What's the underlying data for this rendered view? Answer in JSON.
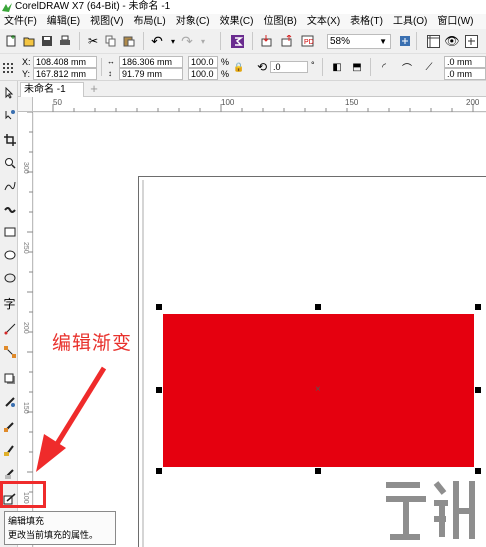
{
  "window": {
    "title": "CorelDRAW X7 (64-Bit) - 未命名 -1"
  },
  "menu": [
    "文件(F)",
    "编辑(E)",
    "视图(V)",
    "布局(L)",
    "对象(C)",
    "效果(C)",
    "位图(B)",
    "文本(X)",
    "表格(T)",
    "工具(O)",
    "窗口(W)"
  ],
  "toolbar": {
    "zoom": "58%"
  },
  "props": {
    "x": "108.408 mm",
    "y": "167.812 mm",
    "w": "186.306 mm",
    "h": "91.79 mm",
    "sx": "100.0",
    "sy": "100.0",
    "pct1": "%",
    "pct2": "%",
    "angle": ".0",
    "deg": "°",
    "r1": ".0 mm",
    "r2": ".0 mm",
    "x_label": "X:",
    "y_label": "Y:"
  },
  "tabs": {
    "doc": "未命名 -1",
    "add": "+"
  },
  "ruler": {
    "h": [
      "50",
      "100",
      "150",
      "200"
    ],
    "v": [
      "300",
      "250",
      "200",
      "150",
      "100"
    ]
  },
  "annotation": "编辑渐变",
  "tooltip": {
    "title": "编辑填充",
    "desc": "更改当前填充的属性。"
  },
  "colors": {
    "fill": "#e5000f",
    "highlight": "#ef2b2b",
    "annotation": "#e8312c"
  },
  "icons": [
    "corel-logo-icon",
    "new-icon",
    "open-icon",
    "save-icon",
    "print-icon",
    "cut-icon",
    "copy-icon",
    "paste-icon",
    "undo-icon",
    "redo-icon",
    "search-icon",
    "import-icon",
    "export-icon",
    "publish-icon",
    "full-screen-icon",
    "rulers-icon",
    "view-icon",
    "snap-icon",
    "lock-icon",
    "rotate-icon",
    "mirror-h-icon",
    "mirror-v-icon",
    "corner-round-icon",
    "corner-scallop-icon",
    "corner-chamfer-icon",
    "pick-tool-icon",
    "shape-tool-icon",
    "crop-tool-icon",
    "zoom-tool-icon",
    "freehand-tool-icon",
    "artistic-media-icon",
    "rectangle-tool-icon",
    "ellipse-tool-icon",
    "polygon-tool-icon",
    "text-tool-icon",
    "parallel-dimension-icon",
    "connector-tool-icon",
    "drop-shadow-icon",
    "transparency-icon",
    "color-eyedropper-icon",
    "interactive-fill-icon",
    "smart-fill-icon",
    "edit-fill-icon",
    "outline-pen-icon"
  ]
}
